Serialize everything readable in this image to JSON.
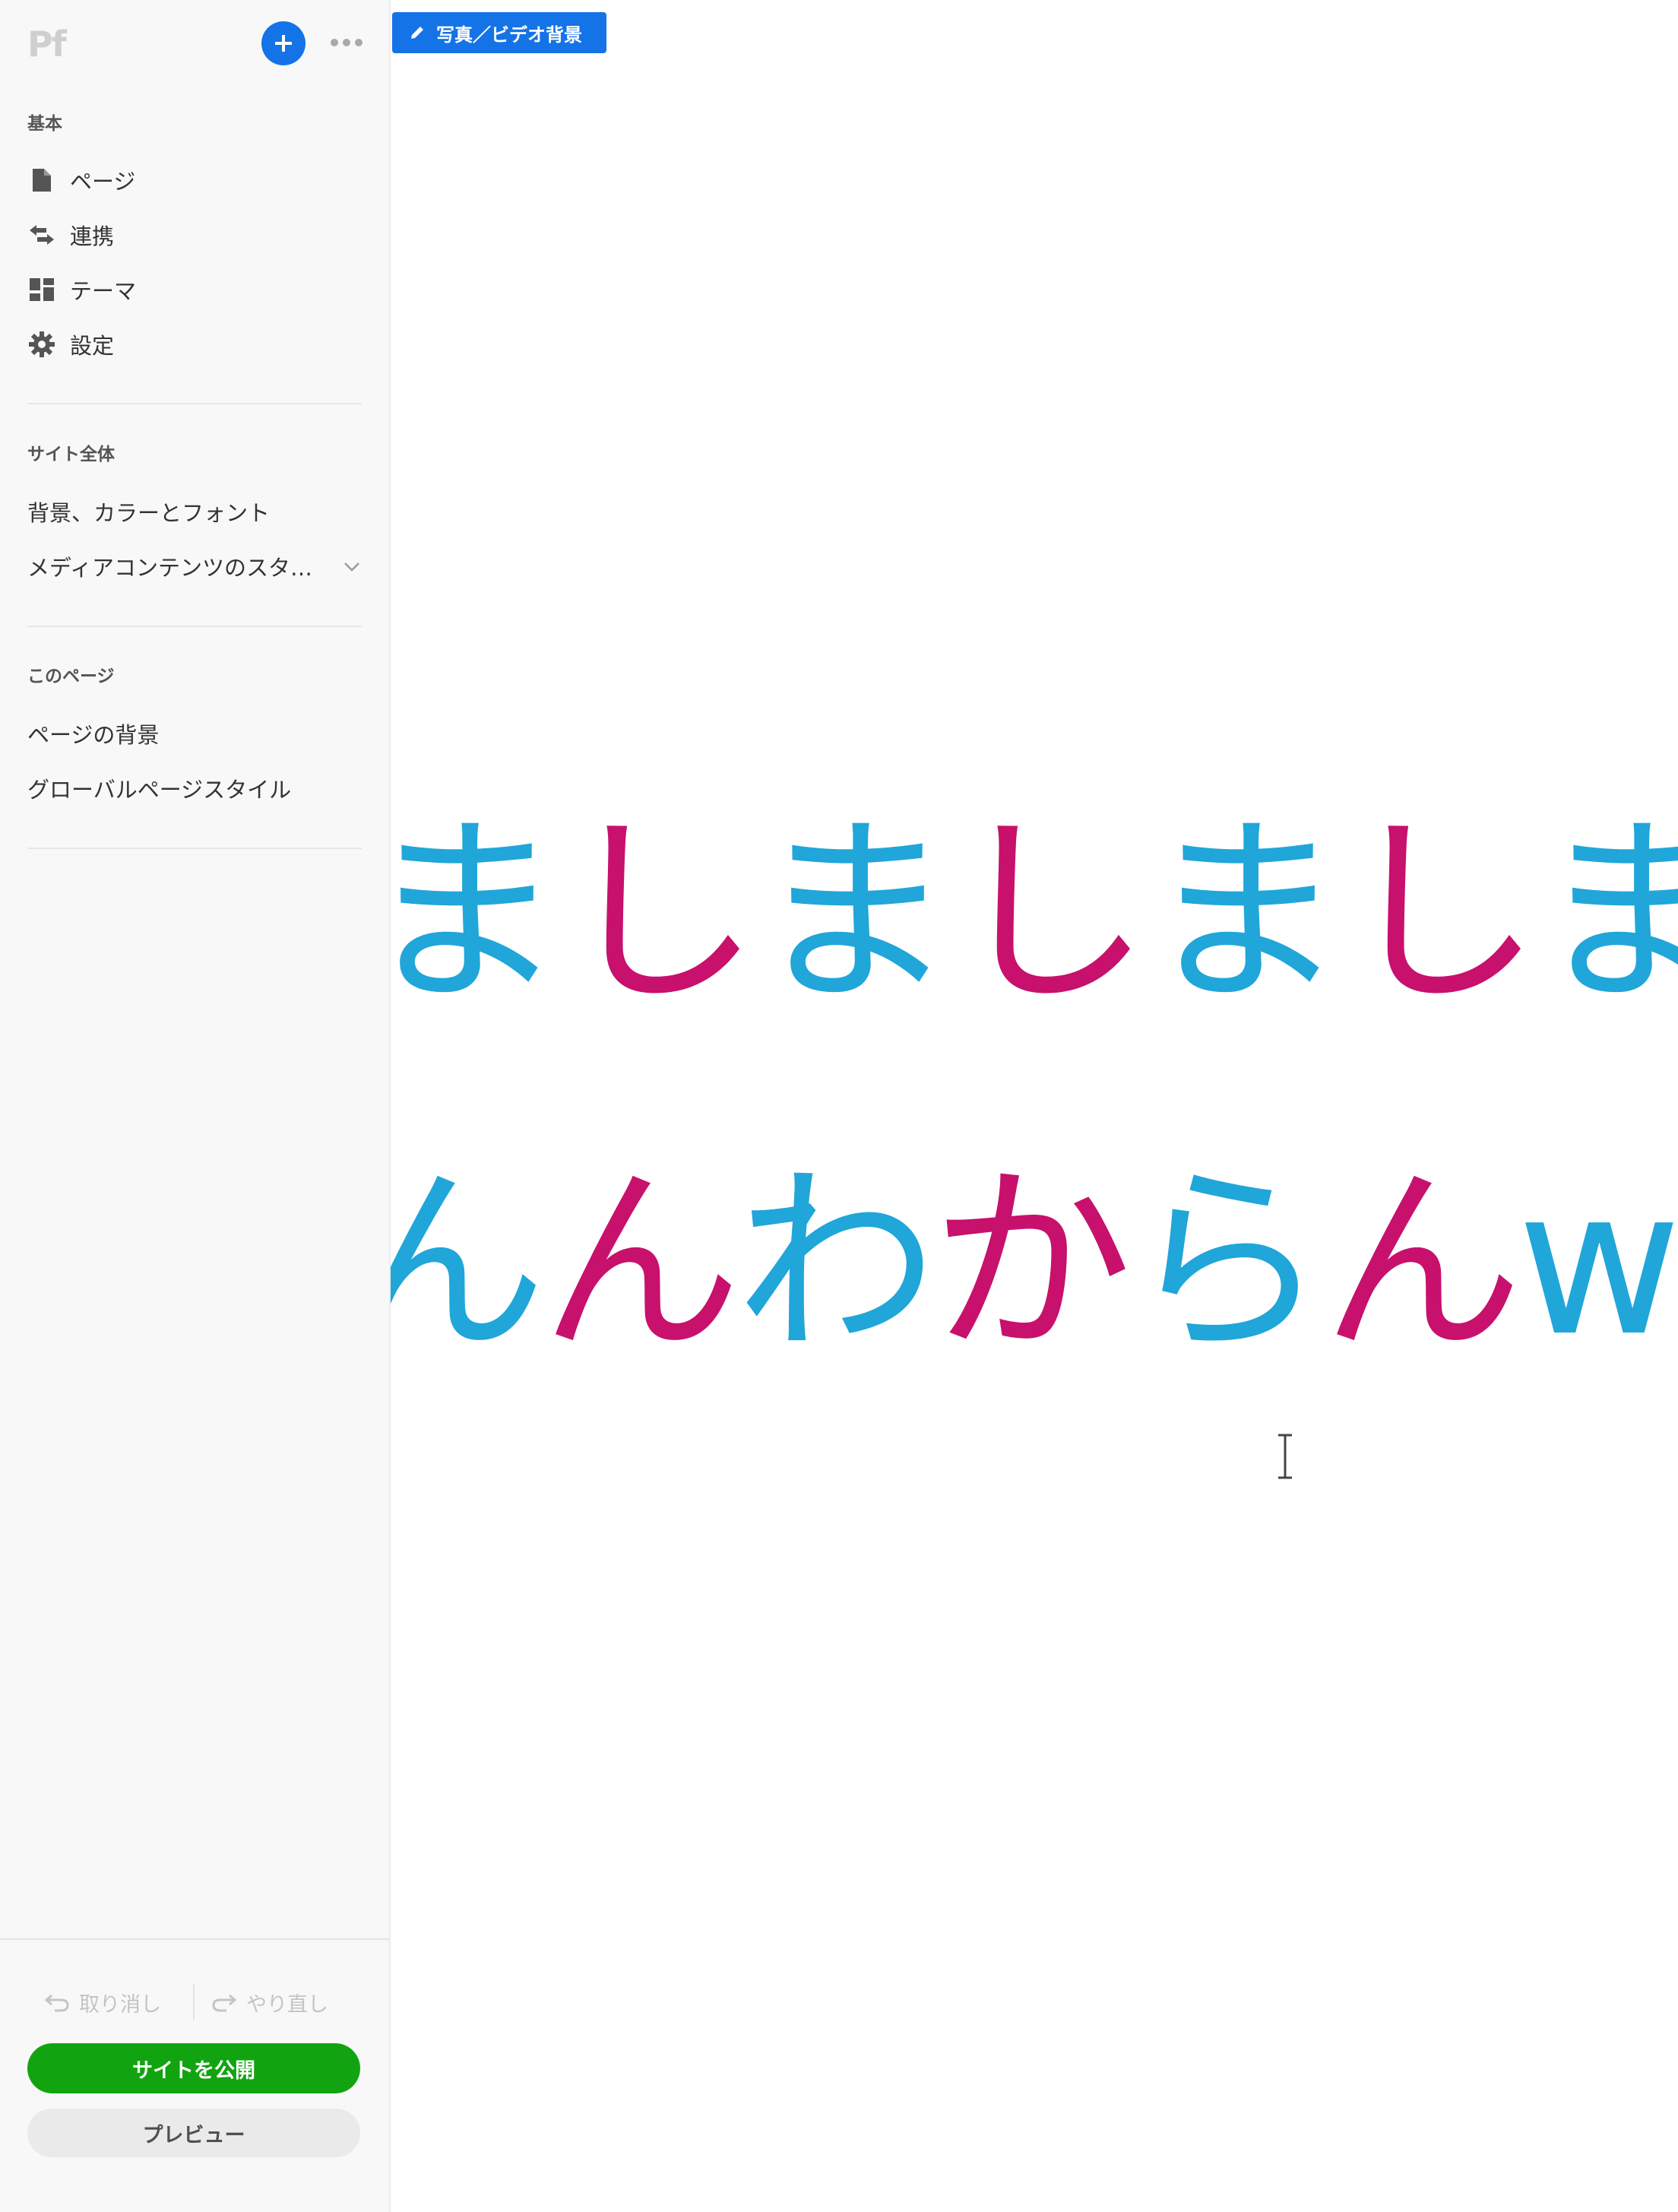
{
  "app": {
    "logo_text": "Pf"
  },
  "sidebar": {
    "basic": {
      "heading": "基本",
      "items": [
        {
          "label": "ページ",
          "icon": "page-icon"
        },
        {
          "label": "連携",
          "icon": "connect-arrows-icon"
        },
        {
          "label": "テーマ",
          "icon": "theme-grid-icon"
        },
        {
          "label": "設定",
          "icon": "gear-icon"
        }
      ]
    },
    "site": {
      "heading": "サイト全体",
      "items": [
        {
          "label": "背景、カラーとフォント"
        },
        {
          "label": "メディアコンテンツのスタ…",
          "has_dropdown": true
        }
      ]
    },
    "this_page": {
      "heading": "このページ",
      "items": [
        {
          "label": "ページの背景"
        },
        {
          "label": "グローバルページスタイル"
        }
      ]
    },
    "undo_label": "取り消し",
    "redo_label": "やり直し",
    "publish_label": "サイトを公開",
    "preview_label": "プレビュー"
  },
  "canvas": {
    "background_chip_label": "写真／ビデオ背景",
    "line1": [
      {
        "text": "ま",
        "color": "cyan"
      },
      {
        "text": "し",
        "color": "pink"
      },
      {
        "text": "ま",
        "color": "cyan"
      },
      {
        "text": "し",
        "color": "pink"
      },
      {
        "text": "ま",
        "color": "cyan"
      },
      {
        "text": "し",
        "color": "pink"
      },
      {
        "text": "ま",
        "color": "cyan"
      }
    ],
    "line2": [
      {
        "text": "ん",
        "color": "cyan"
      },
      {
        "text": "ん",
        "color": "pink"
      },
      {
        "text": "わ",
        "color": "cyan"
      },
      {
        "text": "か",
        "color": "pink"
      },
      {
        "text": "ら",
        "color": "cyan"
      },
      {
        "text": "ん",
        "color": "pink"
      },
      {
        "text": "w",
        "color": "cyan"
      }
    ]
  },
  "colors": {
    "accent_blue": "#1473e6",
    "publish_green": "#12a410",
    "text_pink": "#c8106d",
    "text_cyan": "#20a6d9"
  }
}
